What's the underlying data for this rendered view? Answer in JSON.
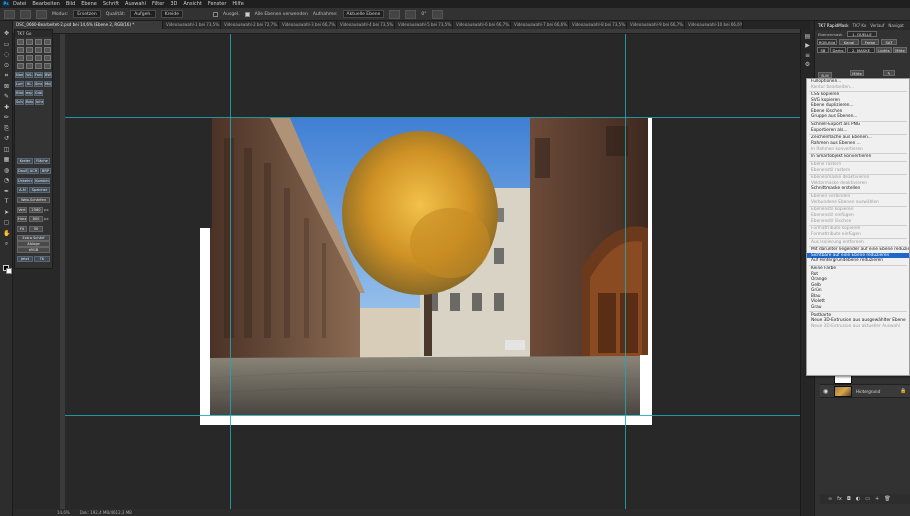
{
  "app": {
    "menu": [
      "Datei",
      "Bearbeiten",
      "Bild",
      "Ebene",
      "Schrift",
      "Auswahl",
      "Filter",
      "3D",
      "Ansicht",
      "Fenster",
      "Hilfe"
    ]
  },
  "options_bar": {
    "modus_label": "Modus:",
    "modus_value": "Ersetzen",
    "quality_label": "Qualität:",
    "align_value": "Aufgeh.",
    "opacity_value": "Kreide",
    "opt_checkbox1": "Ausgel.",
    "opt_checkbox2": "Alle Ebenen verwenden",
    "sample_label": "Aufnahme:",
    "sample_value": "Aktuelle Ebene",
    "angle_value": "0°"
  },
  "tabs": [
    {
      "label": "DSC_0660-Bearbeitet-2.psd bei 14,6% (Ebene 2, RGB/16) *",
      "active": true
    },
    {
      "label": "Videoauswahl-1 bei 73,5%...",
      "active": false
    },
    {
      "label": "Videoauswahl-2 bei 72,7%...",
      "active": false
    },
    {
      "label": "Videoauswahl-3 bei 66,7%...",
      "active": false
    },
    {
      "label": "Videoauswahl-4 bei 73,5%...",
      "active": false
    },
    {
      "label": "Videoauswahl-5 bei 73,5%...",
      "active": false
    },
    {
      "label": "Videoauswahl-6 bei 66,7%...",
      "active": false
    },
    {
      "label": "Videoauswahl-7 bei 66,6%...",
      "active": false
    },
    {
      "label": "Videoauswahl-8 bei 73,5%...",
      "active": false
    },
    {
      "label": "Videoauswahl-9 bei 66,7%...",
      "active": false
    },
    {
      "label": "Videoauswahl-10 bei 66,6%...",
      "active": false
    }
  ],
  "tk7": {
    "title": "TK7 Go",
    "buttons": [
      "Norm",
      "WL",
      "Farbe",
      "BW",
      "Lum",
      "HL",
      "Smrt",
      "Mult",
      "Bild",
      "expl",
      "Größe",
      "Schrf",
      "Rotate",
      "Inhalt",
      "Kreier",
      "Fläche",
      "Dauß",
      "ACR",
      "BRP",
      "Unkehrv",
      "Kombin",
      "A-M",
      "Speicher",
      "Web-Schärfen",
      "Vert",
      "Horz",
      "Fit",
      "Extra Schärf",
      "Ablage",
      "sRGB",
      "Jetzt",
      "TK"
    ],
    "values": [
      "2560",
      "800",
      "50"
    ],
    "units": [
      "px",
      "px"
    ]
  },
  "status": {
    "zoom": "14,6%",
    "doc": "Dok: 192,4 MB/4612,3 MB"
  },
  "right_panel": {
    "header": "TK7 RapidMask",
    "tabs": [
      "TK7 Go",
      "TK7 Ko",
      "Verlauf",
      "Navigat"
    ],
    "subheader": "Ebenenmask",
    "rp_buttons": [
      "1. QUELLE",
      "RGB-Bild",
      "Kanal",
      "Farbe",
      "SAT",
      "SB",
      "Darks",
      "2. MASKE",
      "Lights",
      "Mitte",
      "B-M",
      "Mitte"
    ],
    "channel_select": "RGB-Bild"
  },
  "context_menu": {
    "items": [
      {
        "t": "Fülloptionen...",
        "d": false
      },
      {
        "t": "Kontur bearbeiten...",
        "d": true
      },
      {
        "sep": true
      },
      {
        "t": "CSS kopieren",
        "d": false
      },
      {
        "t": "SVG kopieren",
        "d": false
      },
      {
        "t": "Ebene duplizieren...",
        "d": false
      },
      {
        "t": "Ebene löschen",
        "d": false
      },
      {
        "t": "Gruppe aus Ebenen...",
        "d": false
      },
      {
        "sep": true
      },
      {
        "t": "Schnell-Export als PNG",
        "d": false
      },
      {
        "t": "Exportieren als...",
        "d": false
      },
      {
        "sep": true
      },
      {
        "t": "Zeichenfläche aus Ebenen...",
        "d": false
      },
      {
        "t": "Rahmen aus Ebenen ...",
        "d": false
      },
      {
        "t": "In Rahmen konvertieren",
        "d": true
      },
      {
        "sep": true
      },
      {
        "t": "In Smartobjekt konvertieren",
        "d": false
      },
      {
        "sep": true
      },
      {
        "t": "Ebene rastern",
        "d": true
      },
      {
        "t": "Ebenenstil rastern",
        "d": true
      },
      {
        "sep": true
      },
      {
        "t": "Ebenenmaske deaktivieren",
        "d": true
      },
      {
        "t": "Vektormaske deaktivieren",
        "d": true
      },
      {
        "t": "Schnittmaske erstellen",
        "d": false
      },
      {
        "sep": true
      },
      {
        "t": "Ebenen verbinden",
        "d": true
      },
      {
        "t": "Verbundene Ebenen auswählen",
        "d": true
      },
      {
        "sep": true
      },
      {
        "t": "Ebenenstil kopieren",
        "d": true
      },
      {
        "t": "Ebenenstil einfügen",
        "d": true
      },
      {
        "t": "Ebenenstil löschen",
        "d": true
      },
      {
        "sep": true
      },
      {
        "t": "Formattribute kopieren",
        "d": true
      },
      {
        "t": "Formattribute einfügen",
        "d": true
      },
      {
        "sep": true
      },
      {
        "t": "Aus Isolierung entfernen",
        "d": true
      },
      {
        "sep": true
      },
      {
        "t": "Mit darunter liegender auf eine Ebene reduzieren",
        "d": false
      },
      {
        "t": "Sichtbare auf eine Ebene reduzieren",
        "d": false,
        "hl": true
      },
      {
        "t": "Auf Hintergrundebene reduzieren",
        "d": false
      },
      {
        "sep": true
      },
      {
        "t": "Keine Farbe",
        "d": false
      },
      {
        "t": "Rot",
        "d": false
      },
      {
        "t": "Orange",
        "d": false
      },
      {
        "t": "Gelb",
        "d": false
      },
      {
        "t": "Grün",
        "d": false
      },
      {
        "t": "Blau",
        "d": false
      },
      {
        "t": "Violett",
        "d": false
      },
      {
        "t": "Grau",
        "d": false
      },
      {
        "sep": true
      },
      {
        "t": "Postkarte",
        "d": false
      },
      {
        "t": "Neue 3D-Extrusion aus ausgewählter Ebene",
        "d": false
      },
      {
        "t": "Neue 3D-Extrusion aus aktueller Auswahl",
        "d": true
      }
    ]
  },
  "layers": {
    "background_name": "Hintergrund"
  },
  "colors": {
    "guide": "#23a6b5",
    "highlight": "#1e66c8",
    "ui_dark": "#282828"
  }
}
